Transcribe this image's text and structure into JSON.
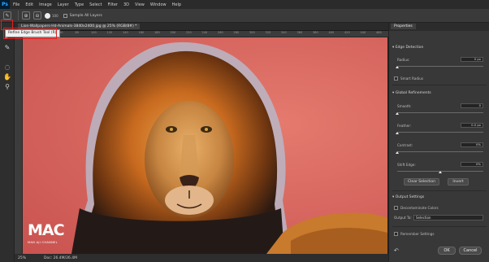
{
  "app": {
    "logo": "Ps"
  },
  "menu": [
    "File",
    "Edit",
    "Image",
    "Layer",
    "Type",
    "Select",
    "Filter",
    "3D",
    "View",
    "Window",
    "Help"
  ],
  "options_bar": {
    "brush_size": "100",
    "sample_all_layers_label": "Sample All Layers"
  },
  "tools": {
    "tooltip": "Refine Edge Brush Tool (R)"
  },
  "document": {
    "tab_title": "Lion-Wallpapers-Hd-Animals-3840x2400.jpg @ 25% (RGB/8#) *",
    "ruler_ticks": [
      "20",
      "40",
      "60",
      "80",
      "100",
      "120",
      "140",
      "160",
      "180",
      "200",
      "220",
      "240",
      "260",
      "280",
      "300",
      "320",
      "340",
      "360",
      "380",
      "400",
      "420",
      "440",
      "460"
    ],
    "zoom": "25%",
    "doc_size": "Doc: 26.4M/26.4M"
  },
  "watermark": {
    "title": "MAC",
    "subtitle": "MAN AJI CHANNEL"
  },
  "properties": {
    "tab": "Properties",
    "edge_detection": {
      "heading": "Edge Detection",
      "radius_label": "Radius:",
      "radius_value": "0 px",
      "smart_radius_label": "Smart Radius"
    },
    "global_refinements": {
      "heading": "Global Refinements",
      "smooth_label": "Smooth:",
      "smooth_value": "0",
      "feather_label": "Feather:",
      "feather_value": "0.0 px",
      "contrast_label": "Contrast:",
      "contrast_value": "0%",
      "shift_edge_label": "Shift Edge:",
      "shift_edge_value": "0%",
      "clear_selection_label": "Clear Selection",
      "invert_label": "Invert"
    },
    "output_settings": {
      "heading": "Output Settings",
      "decontaminate_label": "Decontaminate Colors",
      "output_to_label": "Output To:",
      "output_to_value": "Selection",
      "remember_label": "Remember Settings"
    },
    "ok_label": "OK",
    "cancel_label": "Cancel"
  },
  "colors": {
    "background": "#d9685f",
    "highlight": "#e02020",
    "panel": "#383838"
  },
  "icons": [
    "refine-edge-brush-icon",
    "brush-icon",
    "lasso-icon",
    "hand-icon",
    "zoom-icon",
    "undo-icon"
  ]
}
